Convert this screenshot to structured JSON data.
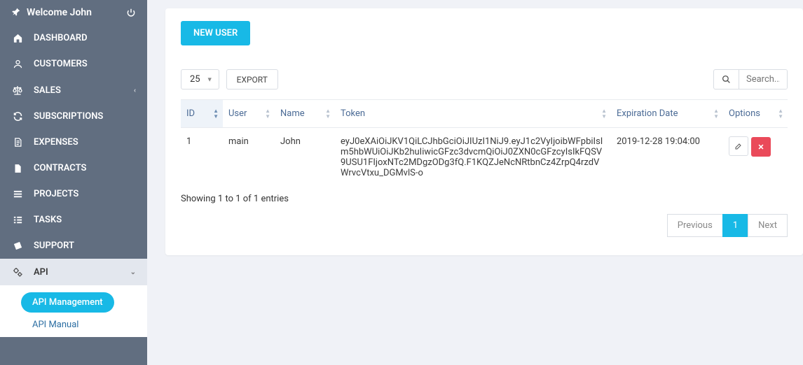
{
  "header": {
    "welcome": "Welcome John"
  },
  "nav": {
    "dashboard": "DASHBOARD",
    "customers": "CUSTOMERS",
    "sales": "SALES",
    "subscriptions": "SUBSCRIPTIONS",
    "expenses": "EXPENSES",
    "contracts": "CONTRACTS",
    "projects": "PROJECTS",
    "tasks": "TASKS",
    "support": "SUPPORT",
    "api": "API",
    "api_mgmt": "API Management",
    "api_manual": "API Manual"
  },
  "main": {
    "new_user": "NEW USER",
    "page_size": "25",
    "export": "EXPORT",
    "search_placeholder": "Search...",
    "columns": {
      "id": "ID",
      "user": "User",
      "name": "Name",
      "token": "Token",
      "expiration": "Expiration Date",
      "options": "Options"
    },
    "row": {
      "id": "1",
      "user": "main",
      "name": "John",
      "token": "eyJ0eXAiOiJKV1QiLCJhbGciOiJIUzI1NiJ9.eyJ1c2VyIjoibWFpbiIsIm5hbWUiOiJKb2huIiwicGFzc3dvcmQiOiJ0ZXN0cGFzcyIsIkFQSV9USU1FIjoxNTc2MDgzODg3fQ.F1KQZJeNcNRtbnCz4ZrpQ4rzdVWrvcVtxu_DGMvlS-o",
      "expiration": "2019-12-28 19:04:00"
    },
    "info": "Showing 1 to 1 of 1 entries",
    "prev": "Previous",
    "page": "1",
    "next": "Next"
  }
}
